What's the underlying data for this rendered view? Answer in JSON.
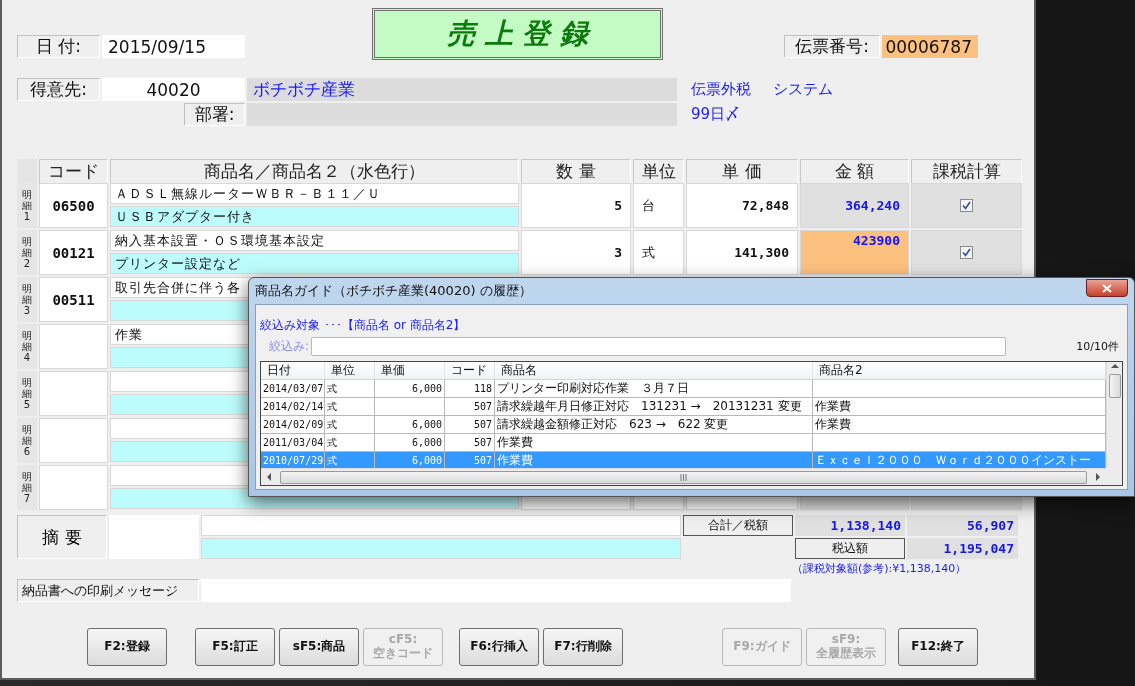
{
  "header": {
    "title": "売 上 登 録"
  },
  "date": {
    "label": "日 付:",
    "value": "2015/09/15"
  },
  "voucher": {
    "label": "伝票番号:",
    "value": "00006787"
  },
  "customer": {
    "label": "得意先:",
    "code": "40020",
    "name": "ボチボチ産業",
    "dept_label": "部署:",
    "notes": [
      "伝票外税",
      "システム"
    ],
    "closing": "99日〆"
  },
  "table": {
    "columns": [
      "コード",
      "商品名／商品名２（水色行）",
      "数 量",
      "単位",
      "単 価",
      "金 額",
      "課税計算"
    ],
    "rows": [
      {
        "label": "明細1",
        "code": "06500",
        "name": "ＡＤＳＬ無線ルーターＷＢＲ－Ｂ１１／Ｕ",
        "name2": "ＵＳＢアダプター付き",
        "qty": "5",
        "unit": "台",
        "price": "72,848",
        "amount": "364,240",
        "amount_editing": false,
        "taxed": true
      },
      {
        "label": "明細2",
        "code": "00121",
        "name": "納入基本設置・ＯＳ環境基本設定",
        "name2": "プリンター設定など",
        "qty": "3",
        "unit": "式",
        "price": "141,300",
        "amount": "423900",
        "amount_editing": true,
        "taxed": true
      },
      {
        "label": "明細3",
        "code": "00511",
        "name": "取引先合併に伴う各"
      },
      {
        "label": "明細4",
        "name": "作業"
      },
      {
        "label": "明細5"
      },
      {
        "label": "明細6"
      },
      {
        "label": "明細7"
      }
    ]
  },
  "summary": {
    "label": "摘 要",
    "total_label": "合計／税額",
    "subtotal": "1,138,140",
    "tax": "56,907",
    "grand_label": "税込額",
    "grand_total": "1,195,047",
    "reference": "（課税対象額(参考):¥1,138,140）"
  },
  "message": {
    "label": "納品書への印刷メッセージ"
  },
  "button_groups": [
    [
      {
        "label": "F2:登録",
        "disabled": false
      }
    ],
    [
      {
        "label": "F5:訂正",
        "disabled": false
      },
      {
        "label": "sF5:商品",
        "disabled": false
      },
      {
        "label": "cF5:\n空きコード",
        "disabled": true
      }
    ],
    [
      {
        "label": "F6:行挿入",
        "disabled": false
      },
      {
        "label": "F7:行削除",
        "disabled": false
      }
    ],
    [
      {
        "label": "F9:ガイド",
        "disabled": true
      },
      {
        "label": "sF9:\n全履歴表示",
        "disabled": true
      }
    ],
    [
      {
        "label": "F12:終了",
        "disabled": false
      }
    ]
  ],
  "dialog": {
    "title": "商品名ガイド（ボチボチ産業(40020) の履歴）",
    "filter_target": "絞込み対象 ･･･【商品名 or 商品名2】",
    "filter_label": "絞込み:",
    "count": "10/10件",
    "columns": [
      "日付",
      "単位",
      "単価",
      "コード",
      "商品名",
      "商品名2"
    ],
    "rows": [
      {
        "cells": [
          "2014/03/07",
          "式",
          "6,000",
          "118",
          "プリンター印刷対応作業　３月７日",
          ""
        ],
        "selected": false
      },
      {
        "cells": [
          "2014/02/14",
          "式",
          "",
          "507",
          "請求繰越年月日修正対応　131231 →　20131231 変更",
          "作業費"
        ],
        "selected": false
      },
      {
        "cells": [
          "2014/02/09",
          "式",
          "6,000",
          "507",
          "請求繰越金額修正対応　623 →　622 変更",
          "作業費"
        ],
        "selected": false
      },
      {
        "cells": [
          "2011/03/04",
          "式",
          "6,000",
          "507",
          "作業費",
          ""
        ],
        "selected": false
      },
      {
        "cells": [
          "2010/07/29",
          "式",
          "6,000",
          "507",
          "作業費",
          "Ｅｘｃｅｌ２０００　Ｗｏｒｄ２０００インストー"
        ],
        "selected": true
      }
    ]
  }
}
